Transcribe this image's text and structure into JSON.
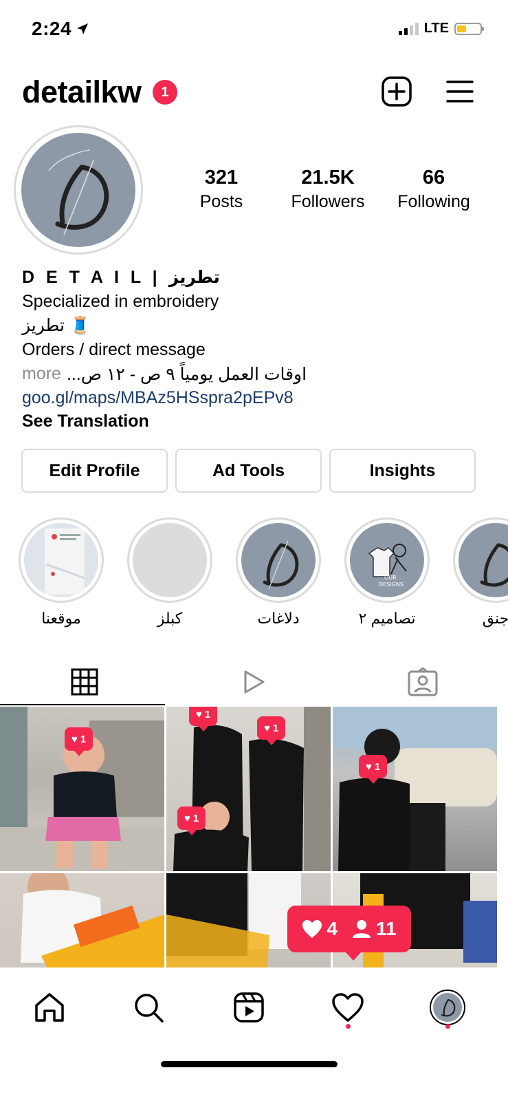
{
  "status_bar": {
    "time": "2:24",
    "network": "LTE"
  },
  "header": {
    "username": "detailkw",
    "notification_count": "1"
  },
  "stats": [
    {
      "value": "321",
      "label": "Posts"
    },
    {
      "value": "21.5K",
      "label": "Followers"
    },
    {
      "value": "66",
      "label": "Following"
    }
  ],
  "bio": {
    "name": "D E T A I L | تطريز",
    "line1": "Specialized in embroidery",
    "line2": "تطريز 🧵",
    "line3": "Orders / direct message",
    "line4": "اوقات العمل يومياً ٩ ص - ١٢ ص...",
    "more": "more",
    "link": "goo.gl/maps/MBAz5HSspra2pEPv8",
    "see_translation": "See Translation"
  },
  "buttons": {
    "edit_profile": "Edit Profile",
    "ad_tools": "Ad Tools",
    "insights": "Insights"
  },
  "highlights": [
    {
      "label": "موقعنا"
    },
    {
      "label": "كبلز"
    },
    {
      "label": "دلاغات"
    },
    {
      "label": "تصاميم ٢"
    },
    {
      "label": "جنق"
    }
  ],
  "posts": [
    {
      "likes": "1"
    },
    {
      "likes": "1"
    },
    {
      "likes": "1"
    },
    {
      "likes": "1"
    },
    {
      "likes": "1"
    }
  ],
  "activity": {
    "likes": "4",
    "follows": "11"
  },
  "icons": {
    "tabs": [
      "grid-icon",
      "reels-icon",
      "tagged-icon"
    ],
    "nav": [
      "home-icon",
      "search-icon",
      "reels-icon",
      "heart-icon",
      "profile-avatar"
    ]
  },
  "colors": {
    "accent": "#f2284f",
    "link": "#1a3c6e",
    "muted": "#8e8e8e"
  }
}
